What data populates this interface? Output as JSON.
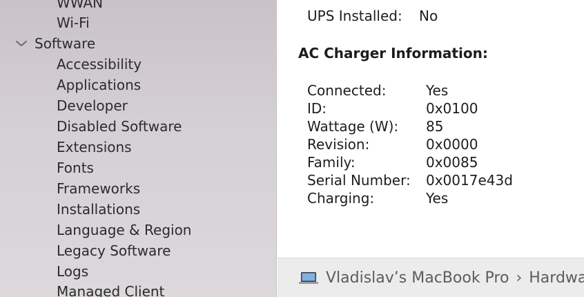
{
  "sidebar": {
    "items": [
      {
        "label": "WWAN",
        "type": "child"
      },
      {
        "label": "Wi-Fi",
        "type": "child"
      },
      {
        "label": "Software",
        "type": "group",
        "expanded": true
      },
      {
        "label": "Accessibility",
        "type": "child"
      },
      {
        "label": "Applications",
        "type": "child"
      },
      {
        "label": "Developer",
        "type": "child"
      },
      {
        "label": "Disabled Software",
        "type": "child"
      },
      {
        "label": "Extensions",
        "type": "child"
      },
      {
        "label": "Fonts",
        "type": "child"
      },
      {
        "label": "Frameworks",
        "type": "child"
      },
      {
        "label": "Installations",
        "type": "child"
      },
      {
        "label": "Language & Region",
        "type": "child"
      },
      {
        "label": "Legacy Software",
        "type": "child"
      },
      {
        "label": "Logs",
        "type": "child"
      },
      {
        "label": "Managed Client",
        "type": "child"
      }
    ]
  },
  "main": {
    "ups": {
      "label": "UPS Installed:",
      "value": "No"
    },
    "section_title": "AC Charger Information:",
    "rows": [
      {
        "label": "Connected:",
        "value": "Yes"
      },
      {
        "label": "ID:",
        "value": "0x0100"
      },
      {
        "label": "Wattage (W):",
        "value": "85"
      },
      {
        "label": "Revision:",
        "value": "0x0000"
      },
      {
        "label": "Family:",
        "value": "0x0085"
      },
      {
        "label": "Serial Number:",
        "value": "0x0017e43d"
      },
      {
        "label": "Charging:",
        "value": "Yes"
      }
    ]
  },
  "footer": {
    "icon": "laptop-icon",
    "breadcrumb": [
      "Vladislav’s MacBook Pro",
      "Hardware"
    ],
    "separator": "›"
  }
}
